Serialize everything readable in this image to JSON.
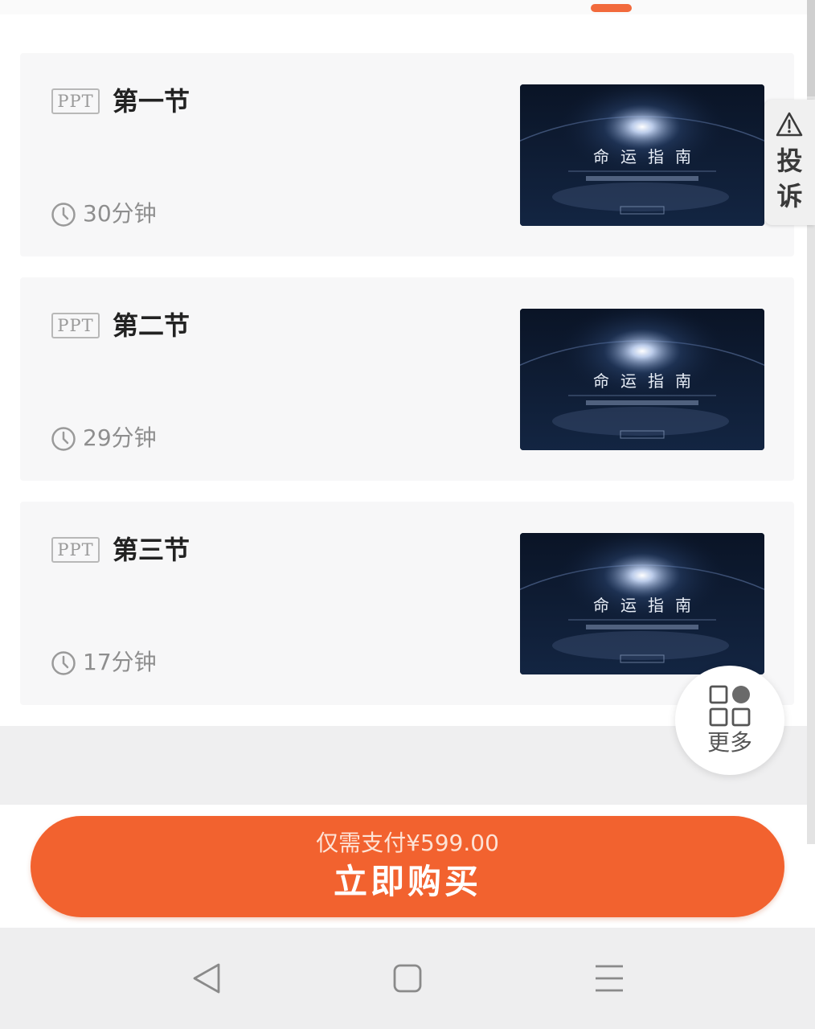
{
  "lessons": [
    {
      "badge": "PPT",
      "title": "第一节",
      "duration": "30分钟",
      "thumb_title": "命运指南"
    },
    {
      "badge": "PPT",
      "title": "第二节",
      "duration": "29分钟",
      "thumb_title": "命运指南"
    },
    {
      "badge": "PPT",
      "title": "第三节",
      "duration": "17分钟",
      "thumb_title": "命运指南"
    }
  ],
  "complaint": {
    "label_1": "投",
    "label_2": "诉",
    "icon": "warning-icon"
  },
  "more": {
    "label": "更多",
    "icon": "apps-grid-icon"
  },
  "purchase": {
    "price_text": "仅需支付¥599.00",
    "button_label": "立即购买"
  },
  "navbar": {
    "icons": [
      "back-triangle-icon",
      "home-square-icon",
      "menu-lines-icon"
    ]
  },
  "colors": {
    "accent": "#f2622f",
    "card_bg": "#f7f7f8",
    "thumb_bg": "#0d1a33"
  }
}
